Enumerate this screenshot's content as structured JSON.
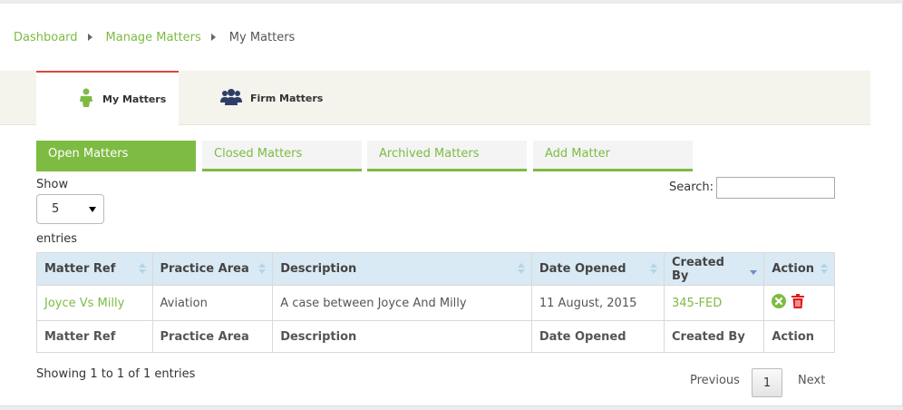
{
  "breadcrumb": {
    "items": [
      "Dashboard",
      "Manage Matters"
    ],
    "current": "My Matters"
  },
  "top_tabs": {
    "my_matters": "My Matters",
    "firm_matters": "Firm Matters"
  },
  "sub_tabs": [
    "Open Matters",
    "Closed Matters",
    "Archived Matters",
    "Add Matter"
  ],
  "controls": {
    "show_label": "Show",
    "page_size": "5",
    "entries_label": "entries",
    "search_label": "Search:",
    "search_value": ""
  },
  "table": {
    "headers": [
      "Matter Ref",
      "Practice Area",
      "Description",
      "Date Opened",
      "Created By",
      "Action"
    ],
    "rows": [
      [
        "Joyce Vs Milly",
        "Aviation",
        "A case between Joyce And Milly",
        "11 August, 2015",
        "345-FED"
      ]
    ]
  },
  "footer": {
    "info": "Showing 1 to 1 of 1 entries",
    "previous": "Previous",
    "page": "1",
    "next": "Next"
  },
  "colors": {
    "accent_green": "#7dbb43",
    "active_tab_top": "#d94a3a",
    "header_bg": "#d9eaf4",
    "delete_red": "#e21a1a"
  }
}
